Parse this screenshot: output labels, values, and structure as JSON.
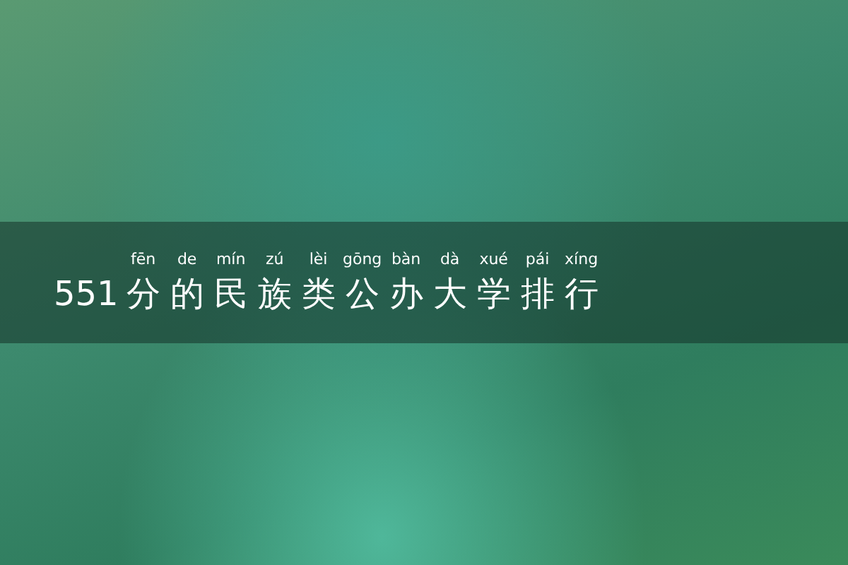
{
  "banner": {
    "prefix": "551",
    "chars": [
      {
        "char": "分",
        "pinyin": "fēn"
      },
      {
        "char": "的",
        "pinyin": "de"
      },
      {
        "char": "民",
        "pinyin": "mín"
      },
      {
        "char": "族",
        "pinyin": "zú"
      },
      {
        "char": "类",
        "pinyin": "lèi"
      },
      {
        "char": "公",
        "pinyin": "gōng"
      },
      {
        "char": "办",
        "pinyin": "bàn"
      },
      {
        "char": "大",
        "pinyin": "dà"
      },
      {
        "char": "学",
        "pinyin": "xué"
      },
      {
        "char": "排",
        "pinyin": "pái"
      },
      {
        "char": "行",
        "pinyin": "xíng"
      }
    ]
  }
}
